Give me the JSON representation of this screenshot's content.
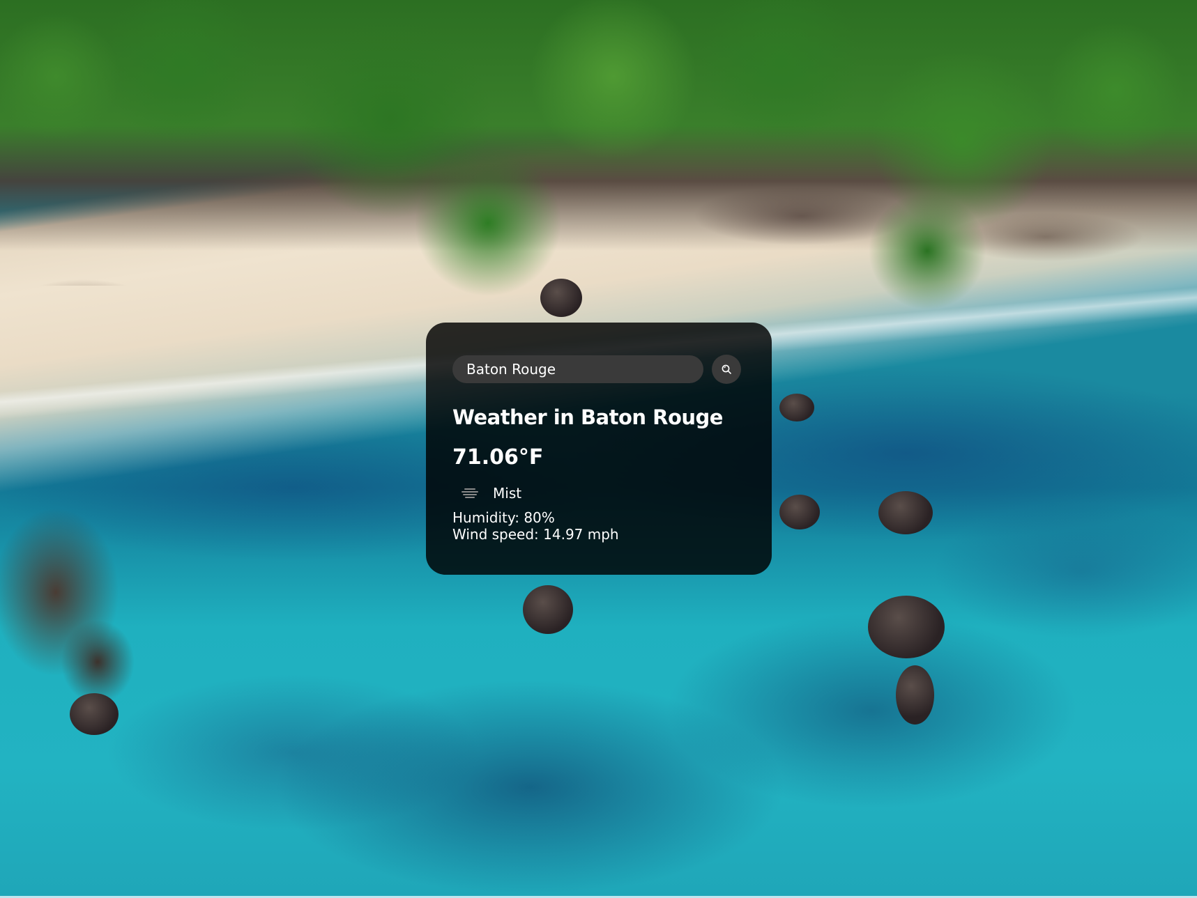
{
  "search": {
    "value": "Baton Rouge",
    "placeholder": "Search",
    "button_icon": "search-icon"
  },
  "weather": {
    "title": "Weather in Baton Rouge",
    "temperature": "71.06°F",
    "icon": "mist-icon",
    "description": "Mist",
    "humidity": "Humidity: 80%",
    "wind": "Wind speed: 14.97 mph"
  },
  "colors": {
    "card_background": "#000000",
    "input_background": "#3a3a3a",
    "text": "#ffffff"
  }
}
